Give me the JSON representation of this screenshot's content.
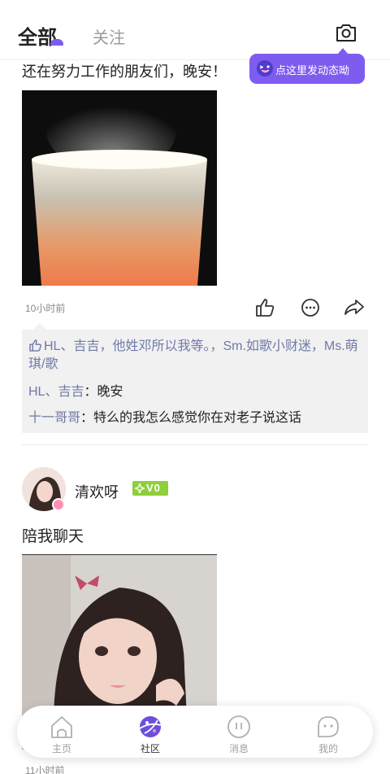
{
  "header": {
    "tab_all": "全部",
    "tab_follow": "关注",
    "tip_text": "点这里发动态呦"
  },
  "post1": {
    "text": "还在努力工作的朋友们，晚安！",
    "time": "10小时前",
    "likes_text": "HL、吉吉，他姓邓所以我等。，Sm.如歌小财迷，Ms.萌琪/歌",
    "comments": [
      {
        "name": "HL、吉吉",
        "sep": "：",
        "text": "晚安"
      },
      {
        "name": "十一哥哥",
        "sep": "：",
        "text": "特么的我怎么感觉你在对老子说这话"
      }
    ]
  },
  "post2": {
    "username": "清欢呀",
    "level": "V0",
    "text": "陪我聊天",
    "time": "11小时前"
  },
  "nav": {
    "items": [
      {
        "label": "主页"
      },
      {
        "label": "社区"
      },
      {
        "label": "消息"
      },
      {
        "label": "我的"
      }
    ],
    "active_index": 1
  },
  "colors": {
    "accent": "#7f5cf0",
    "link": "#6f7aa8",
    "badge_green": "#8fcf3c"
  }
}
